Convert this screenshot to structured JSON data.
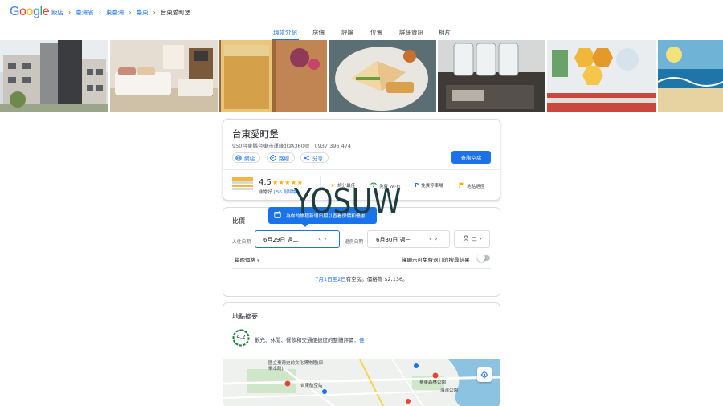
{
  "logo": {
    "text_parts": [
      "G",
      "o",
      "o",
      "g",
      "l",
      "e"
    ]
  },
  "breadcrumbs": {
    "items": [
      "飯店",
      "臺灣省",
      "東臺灣",
      "臺東",
      "台東愛町堡"
    ],
    "separator": "›"
  },
  "tabs": [
    "環境介紹",
    "房價",
    "評論",
    "位置",
    "詳細資訊",
    "相片"
  ],
  "active_tab": "環境介紹",
  "photos": [
    "building-exterior",
    "bedroom",
    "iced-tea",
    "sandwich-plate",
    "drink-dispensers",
    "cafe-interior",
    "ocean-mural"
  ],
  "hotel": {
    "name": "台東愛町堡",
    "address": "950台東縣台東市運隆北路360號 · 0937 396 474",
    "actions": {
      "website": "網站",
      "directions": "路線",
      "share": "分享"
    },
    "check_button": "查詢空房",
    "rating": "4.5",
    "stars": "★★★★★",
    "rating_label": "非常好",
    "reviews_link": "56 則評論",
    "amenities": [
      "評分最佳",
      "免費 Wi-Fi",
      "免費停車場",
      "地點絕佳"
    ]
  },
  "pricing": {
    "title": "比價",
    "tooltip": "為你的旅程新增日期以查看房價和優惠",
    "checkin_label": "入住日期",
    "checkin_value": "6月29日 週二",
    "checkout_label": "退房日期",
    "checkout_value": "6月30日 週三",
    "guests": "二",
    "sort_label": "每晚價格",
    "toggle_label": "僅顯示可免費退訂的搜尋結果",
    "availability_dates": "7月1日至2日",
    "availability_text": "有空房。價格為 $2,136。"
  },
  "location": {
    "title": "地點摘要",
    "score": "4.2",
    "summary": "觀光、休閒、餐飲和交通便捷度的整體評價：",
    "summary_rating": "佳",
    "map_labels": [
      "國立臺灣史前文化博物館(康樂本館)",
      "台東航空站",
      "臺東森林公園",
      "海濱公園"
    ]
  },
  "watermark": "YOSUW",
  "colors": {
    "accent": "#1a73e8",
    "star": "#f9ab00",
    "score_ring": "#188038"
  }
}
